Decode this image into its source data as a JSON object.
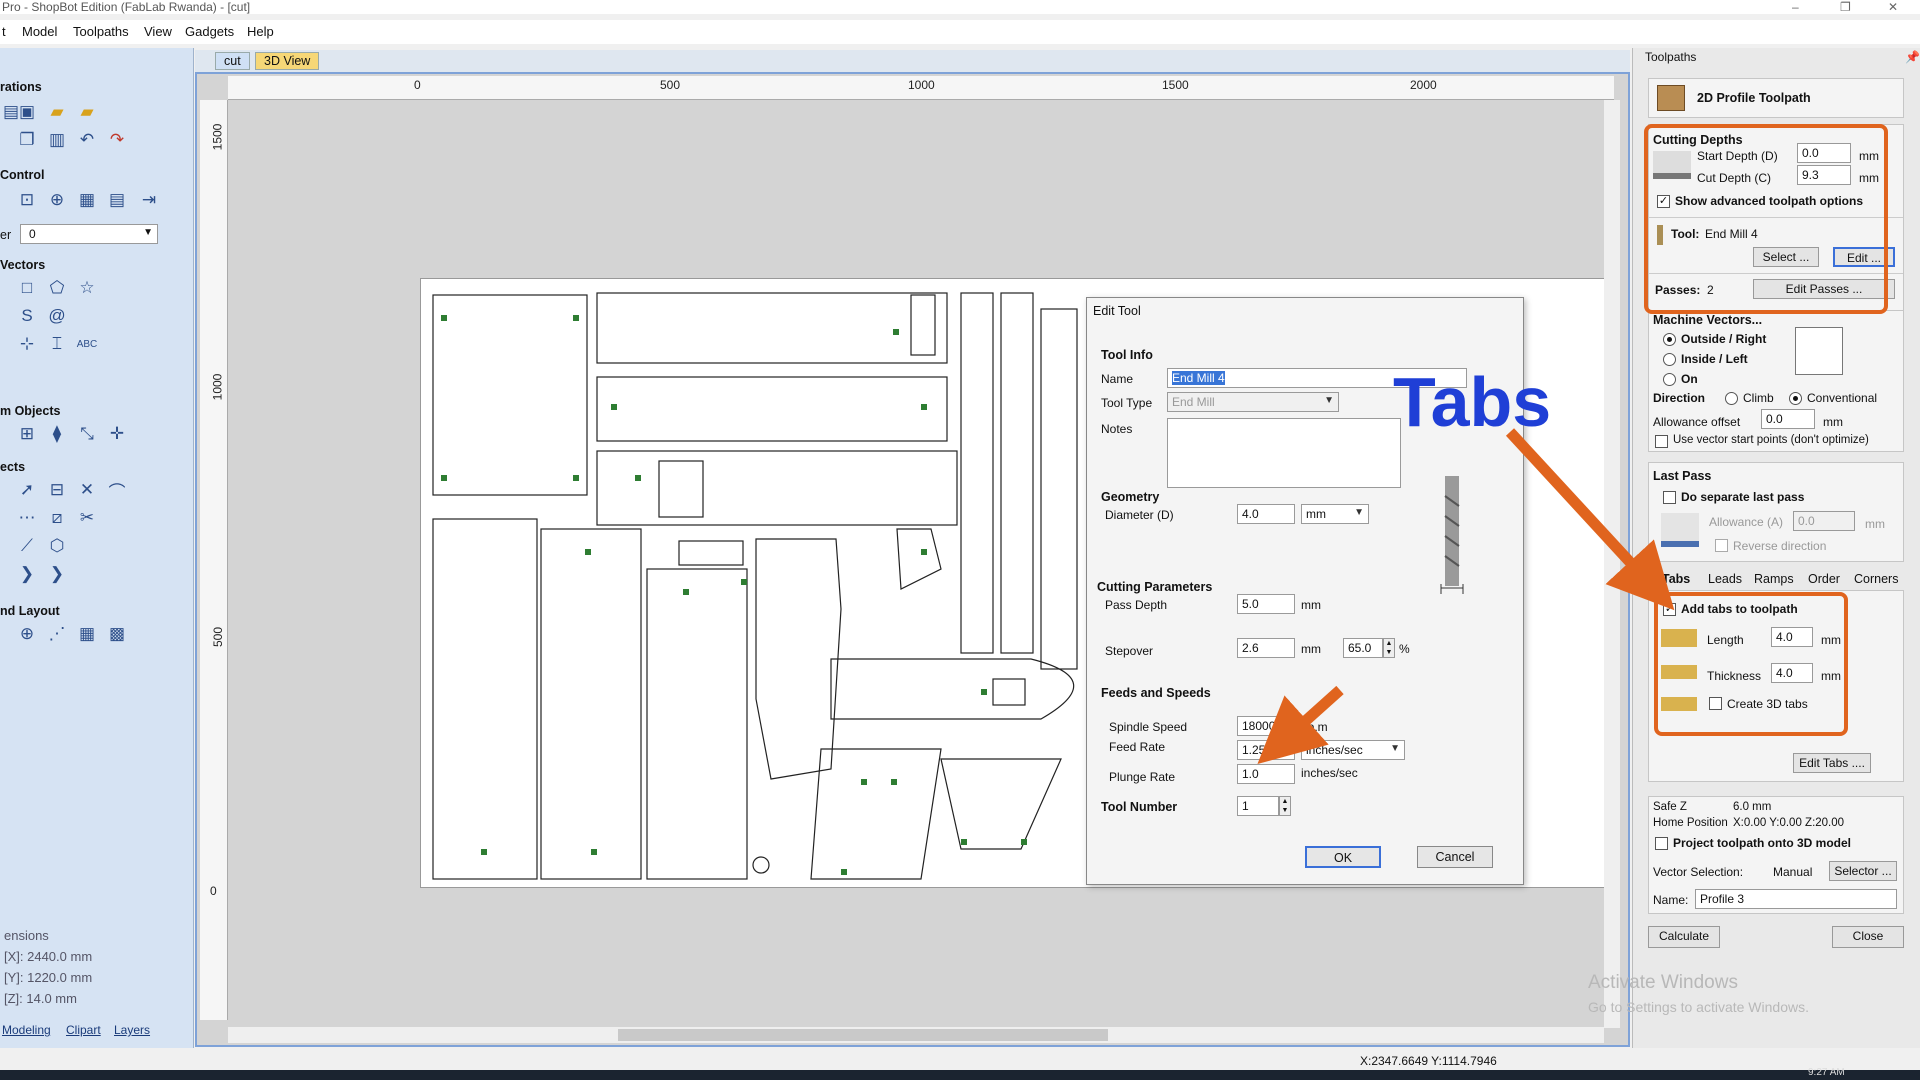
{
  "window": {
    "title": "Pro - ShopBot Edition (FabLab Rwanda) - [cut]",
    "controls": [
      "–",
      "❐",
      "✕"
    ]
  },
  "menu": [
    "t",
    "Model",
    "Toolpaths",
    "View",
    "Gadgets",
    "Help"
  ],
  "left_panel": {
    "sections": [
      "rations",
      "Control",
      "Vectors",
      "m Objects",
      "ects",
      "nd Layout"
    ],
    "layer_label": "er",
    "layer_value": "0",
    "dimensions_title": "ensions",
    "dim_x": "[X]: 2440.0 mm",
    "dim_y": "[Y]: 1220.0 mm",
    "dim_z": "[Z]: 14.0 mm",
    "tabs": [
      "Modeling",
      "Clipart",
      "Layers"
    ]
  },
  "doc_tabs": [
    "cut",
    "3D View"
  ],
  "ruler": {
    "top_labels": [
      "0",
      "500",
      "1000",
      "1500",
      "2000"
    ],
    "left_labels": [
      "1500",
      "1000",
      "500",
      "0"
    ]
  },
  "status_bar": {
    "coords": "X:2347.6649 Y:1114.7946",
    "clock": "9:27 AM"
  },
  "watermark": {
    "line1": "Activate Windows",
    "line2": "Go to Settings to activate Windows."
  },
  "annotation": {
    "tabs_label": "Tabs",
    "arrow_color": "#e0641e",
    "highlight_color": "#e0641e",
    "label_color": "#1f3fd6"
  },
  "edit_tool": {
    "title": "Edit Tool",
    "tool_info": "Tool Info",
    "name_label": "Name",
    "name_value": "End Mill 4",
    "tool_type_label": "Tool Type",
    "tool_type_value": "End Mill",
    "notes_label": "Notes",
    "geometry": "Geometry",
    "diameter_label": "Diameter (D)",
    "diameter_value": "4.0",
    "diameter_unit": "mm",
    "cutting_params": "Cutting Parameters",
    "pass_depth_label": "Pass Depth",
    "pass_depth_value": "5.0",
    "pass_depth_unit": "mm",
    "stepover_label": "Stepover",
    "stepover_value": "2.6",
    "stepover_unit": "mm",
    "stepover_pct_value": "65.0",
    "stepover_pct_unit": "%",
    "feeds_speeds": "Feeds and Speeds",
    "spindle_label": "Spindle Speed",
    "spindle_value": "18000",
    "spindle_unit": "r.p.m",
    "feed_label": "Feed Rate",
    "feed_value": "1.25",
    "feed_unit": "inches/sec",
    "plunge_label": "Plunge Rate",
    "plunge_value": "1.0",
    "plunge_unit": "inches/sec",
    "tool_number_label": "Tool Number",
    "tool_number_value": "1",
    "ok": "OK",
    "cancel": "Cancel"
  },
  "toolpaths": {
    "panel_title": "Toolpaths",
    "header": "2D Profile Toolpath",
    "cutting_depths": "Cutting Depths",
    "start_depth_label": "Start Depth (D)",
    "start_depth_value": "0.0",
    "cut_depth_label": "Cut Depth (C)",
    "cut_depth_value": "9.3",
    "unit": "mm",
    "show_advanced": "Show advanced toolpath options",
    "tool_label": "Tool:",
    "tool_value": "End Mill 4",
    "select_btn": "Select ...",
    "edit_btn": "Edit ...",
    "passes_label": "Passes:",
    "passes_value": "2",
    "edit_passes_btn": "Edit Passes ...",
    "machine_vectors": "Machine Vectors...",
    "outside_right": "Outside / Right",
    "inside_left": "Inside / Left",
    "on": "On",
    "direction_label": "Direction",
    "climb": "Climb",
    "conventional": "Conventional",
    "allowance_label": "Allowance offset",
    "allowance_value": "0.0",
    "use_vector_start": "Use vector start points (don't optimize)",
    "last_pass": "Last Pass",
    "separate_last_pass": "Do separate last pass",
    "allowance_a_label": "Allowance (A)",
    "allowance_a_value": "0.0",
    "reverse_direction": "Reverse direction",
    "tabs": [
      "Tabs",
      "Leads",
      "Ramps",
      "Order",
      "Corners"
    ],
    "add_tabs": "Add tabs to toolpath",
    "length_label": "Length",
    "length_value": "4.0",
    "thickness_label": "Thickness",
    "thickness_value": "4.0",
    "create_3d_tabs": "Create 3D tabs",
    "edit_tabs_btn": "Edit Tabs ....",
    "safe_z_label": "Safe Z",
    "safe_z_value": "6.0 mm",
    "home_label": "Home Position",
    "home_value": "X:0.00 Y:0.00 Z:20.00",
    "project_toolpath": "Project toolpath onto 3D model",
    "vector_selection_label": "Vector Selection:",
    "vector_selection_value": "Manual",
    "selector_btn": "Selector ...",
    "name_label": "Name:",
    "name_value": "Profile 3",
    "calculate_btn": "Calculate",
    "close_btn": "Close"
  }
}
